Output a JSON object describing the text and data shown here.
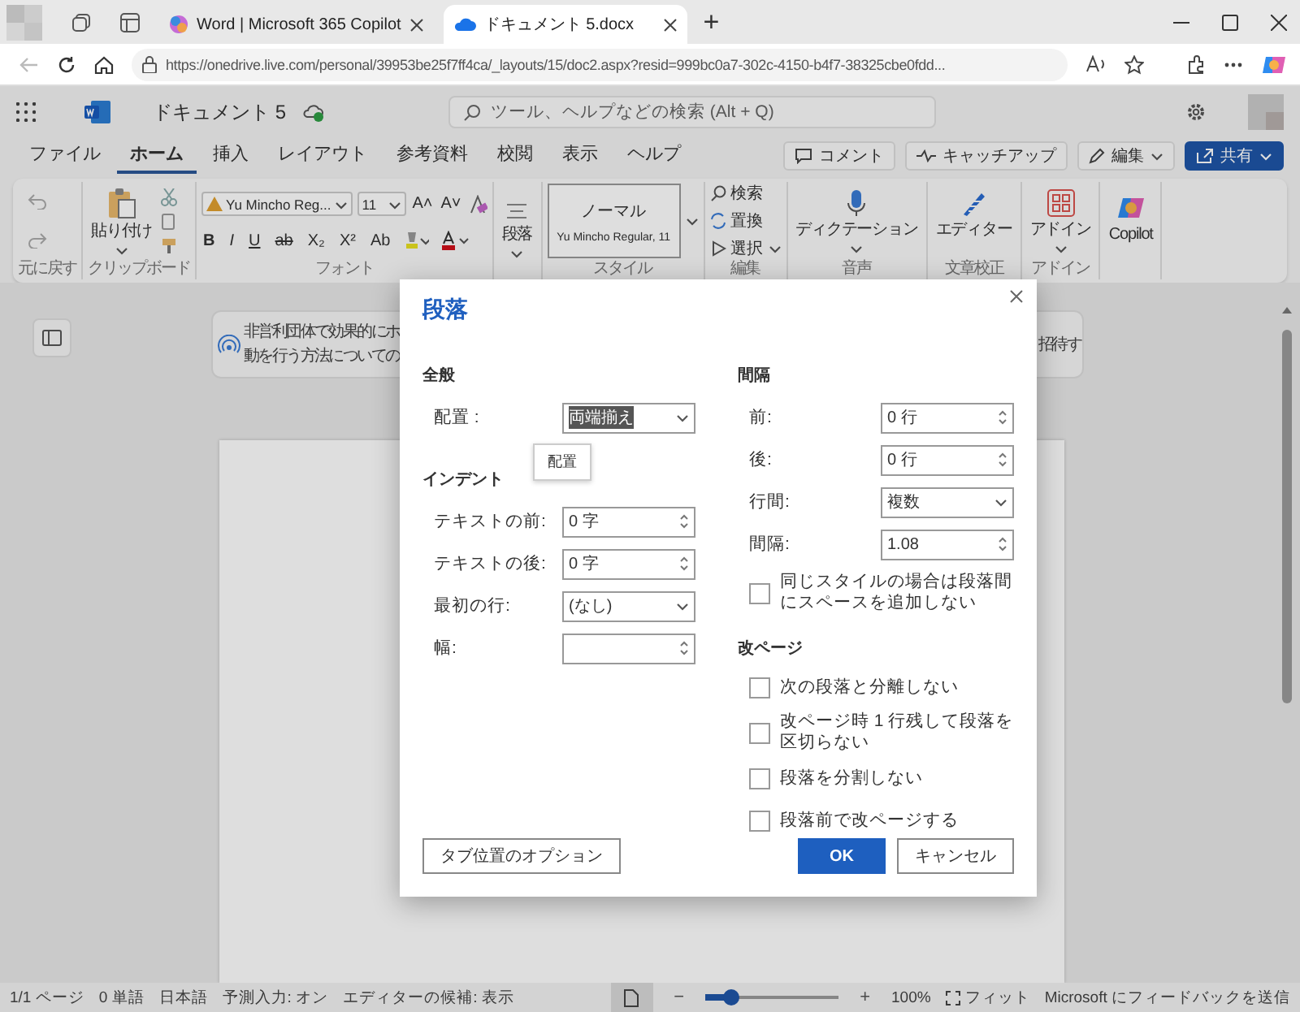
{
  "browser": {
    "tabs": [
      {
        "label": "Word | Microsoft 365 Copilot",
        "kind": "copilot",
        "selected": false
      },
      {
        "label": "ドキュメント 5.docx",
        "kind": "cloud",
        "selected": true
      }
    ],
    "new_tab": "+",
    "address": "https://onedrive.live.com/personal/39953be25f7ff4ca/_layouts/15/doc2.aspx?resid=999bc0a7-302c-4150-b4f7-38325cbe0fdd..."
  },
  "app": {
    "title": "ドキュメント 5",
    "search": {
      "placeholder": "ツール、ヘルプなどの検索 (Alt + Q)"
    },
    "menu_tabs": [
      {
        "label": "ファイル",
        "selected": false
      },
      {
        "label": "ホーム",
        "selected": true
      },
      {
        "label": "挿入",
        "selected": false
      },
      {
        "label": "レイアウト",
        "selected": false
      },
      {
        "label": "参考資料",
        "selected": false
      },
      {
        "label": "校閲",
        "selected": false
      },
      {
        "label": "表示",
        "selected": false
      },
      {
        "label": "ヘルプ",
        "selected": false
      }
    ],
    "actions": [
      {
        "label": "コメント",
        "kind": "comment"
      },
      {
        "label": "キャッチアップ",
        "kind": "catchup"
      },
      {
        "label": "編集",
        "kind": "edit"
      },
      {
        "label": "共有",
        "kind": "share"
      }
    ]
  },
  "ribbon": {
    "groups": [
      {
        "kind": "undo",
        "label": "元に戻す"
      },
      {
        "kind": "clipboard",
        "label": "クリップボード",
        "button": "貼り付け"
      },
      {
        "kind": "font",
        "label": "フォント",
        "font_name": "Yu Mincho Reg...",
        "font_size": "11",
        "size_buttons": [
          "A˄",
          "A˅"
        ],
        "format_buttons": [
          "B",
          "I",
          "U",
          "ab",
          "X₂",
          "X²",
          "Ab"
        ]
      },
      {
        "kind": "paragraph",
        "button": "段落"
      },
      {
        "kind": "styles",
        "label": "スタイル",
        "style_name": "ノーマル",
        "style_detail": "Yu Mincho Regular, 11"
      },
      {
        "kind": "editing",
        "label": "編集",
        "items": [
          "検索",
          "置換",
          "選択"
        ]
      },
      {
        "kind": "dictation",
        "label": "音声",
        "button": "ディクテーション"
      },
      {
        "kind": "editor",
        "label": "文章校正",
        "button": "エディター"
      },
      {
        "kind": "addin",
        "label": "アドイン",
        "button": "アドイン"
      },
      {
        "kind": "copilot",
        "button": "Copilot"
      }
    ]
  },
  "document": {
    "banner": {
      "lines": [
        "非営利団体で効果的にホ",
        "動を行う方法についての"
      ],
      "right_text": "招待す"
    }
  },
  "dialog": {
    "title": "段落",
    "left": [
      {
        "heading": "全般",
        "fields": [
          {
            "label": "配置 :",
            "kind": "select",
            "value": "両端揃え",
            "highlighted": true
          }
        ]
      },
      {
        "heading": "インデント",
        "fields": [
          {
            "label": "テキストの前:",
            "kind": "spin",
            "value": "0 字"
          },
          {
            "label": "テキストの後:",
            "kind": "spin",
            "value": "0 字"
          },
          {
            "label": "最初の行:",
            "kind": "select",
            "value": "(なし)"
          },
          {
            "label": "幅:",
            "kind": "spin"
          }
        ]
      }
    ],
    "tooltip": "配置",
    "spacing": {
      "heading": "間隔",
      "fields": [
        {
          "label": "前:",
          "kind": "spin",
          "value": "0 行"
        },
        {
          "label": "後:",
          "kind": "spin",
          "value": "0 行"
        },
        {
          "label": "行間:",
          "kind": "select",
          "value": "複数"
        },
        {
          "label": "間隔:",
          "kind": "spin",
          "value": "1.08"
        }
      ],
      "checkbox": {
        "label": "同じスタイルの場合は段落間にスペースを追加しない",
        "checked": false
      }
    },
    "page_break": {
      "heading": "改ページ",
      "checkboxes": [
        {
          "label": "次の段落と分離しない",
          "checked": false
        },
        {
          "label": "改ページ時 1 行残して段落を区切らない",
          "checked": false
        },
        {
          "label": "段落を分割しない",
          "checked": false
        },
        {
          "label": "段落前で改ページする",
          "checked": false
        }
      ]
    },
    "buttons": [
      {
        "label": "タブ位置のオプション",
        "kind": "secondary"
      },
      {
        "label": "OK",
        "kind": "primary"
      },
      {
        "label": "キャンセル",
        "kind": "secondary"
      }
    ]
  },
  "status_bar": {
    "items": [
      "1/1 ページ",
      "0 単語",
      "日本語",
      "予測入力: オン",
      "エディターの候補: 表示"
    ],
    "zoom_out": "−",
    "zoom_in": "+",
    "zoom": {
      "level": 0.2
    },
    "zoom_percent": "100%",
    "fit": "フィット",
    "feedback": "Microsoft にフィードバックを送信"
  }
}
